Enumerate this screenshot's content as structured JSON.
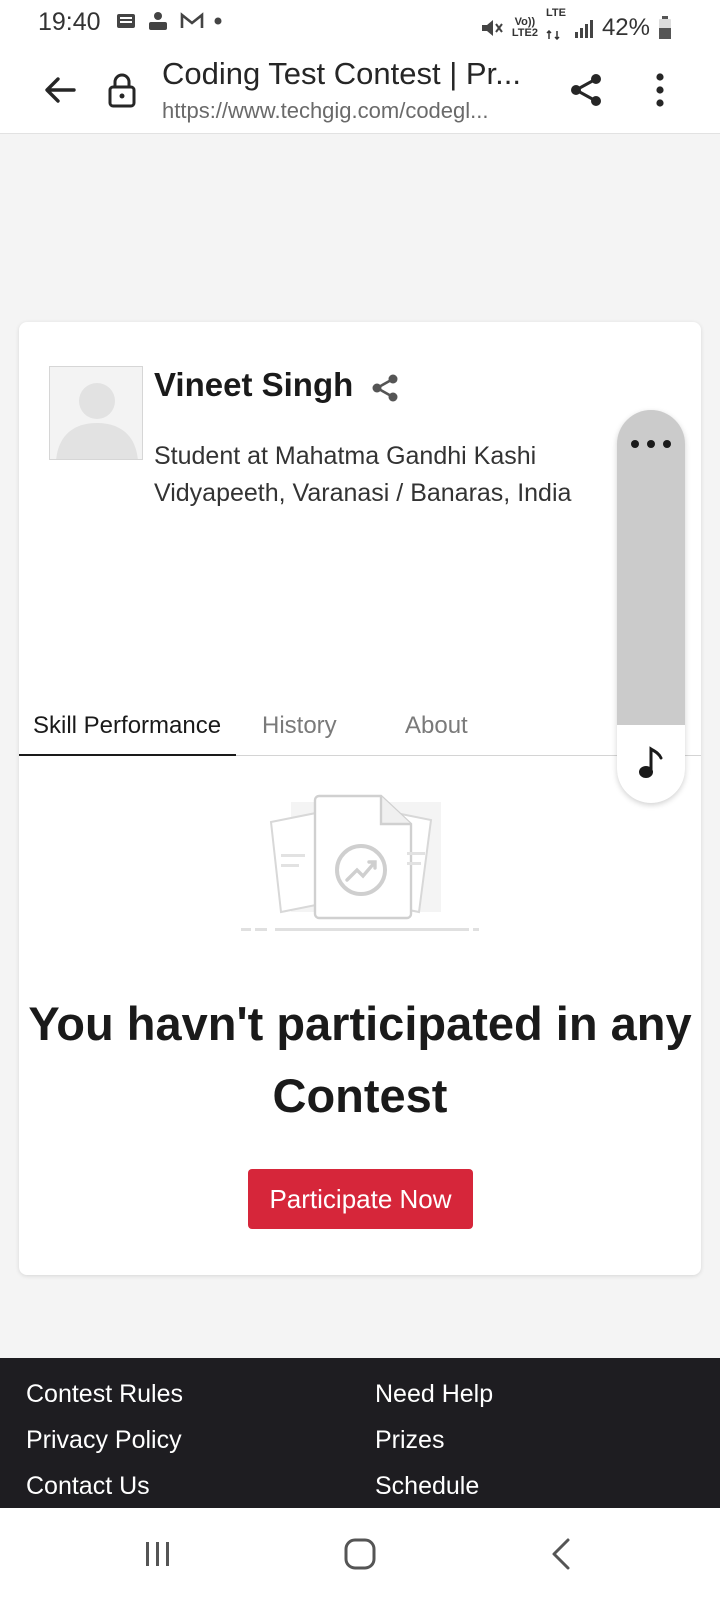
{
  "status_bar": {
    "time": "19:40",
    "network_label_top": "Vo))",
    "network_label_bottom": "LTE2",
    "lte_label": "LTE",
    "battery": "42%"
  },
  "browser": {
    "page_title": "Coding Test Contest | Pr...",
    "url": "https://www.techgig.com/codegl..."
  },
  "profile": {
    "name": "Vineet Singh",
    "subtitle": "Student at Mahatma Gandhi Kashi Vidyapeeth, Varanasi / Banaras, India"
  },
  "tabs": [
    {
      "label": "Skill Performance",
      "active": true
    },
    {
      "label": "History",
      "active": false
    },
    {
      "label": "About",
      "active": false
    }
  ],
  "empty_state": {
    "message": "You havn't participated in any Contest",
    "cta_label": "Participate Now"
  },
  "footer": {
    "links": [
      "Contest Rules",
      "Need Help",
      "Privacy Policy",
      "Prizes",
      "Contact Us",
      "Schedule"
    ]
  },
  "colors": {
    "accent": "#d6263a",
    "footer_bg": "#1e1d21",
    "page_bg": "#f4f4f4"
  },
  "icons": {
    "back": "arrow-left-icon",
    "lock": "lock-icon",
    "share": "share-icon",
    "menu": "more-vertical-icon",
    "music": "music-note-icon"
  }
}
